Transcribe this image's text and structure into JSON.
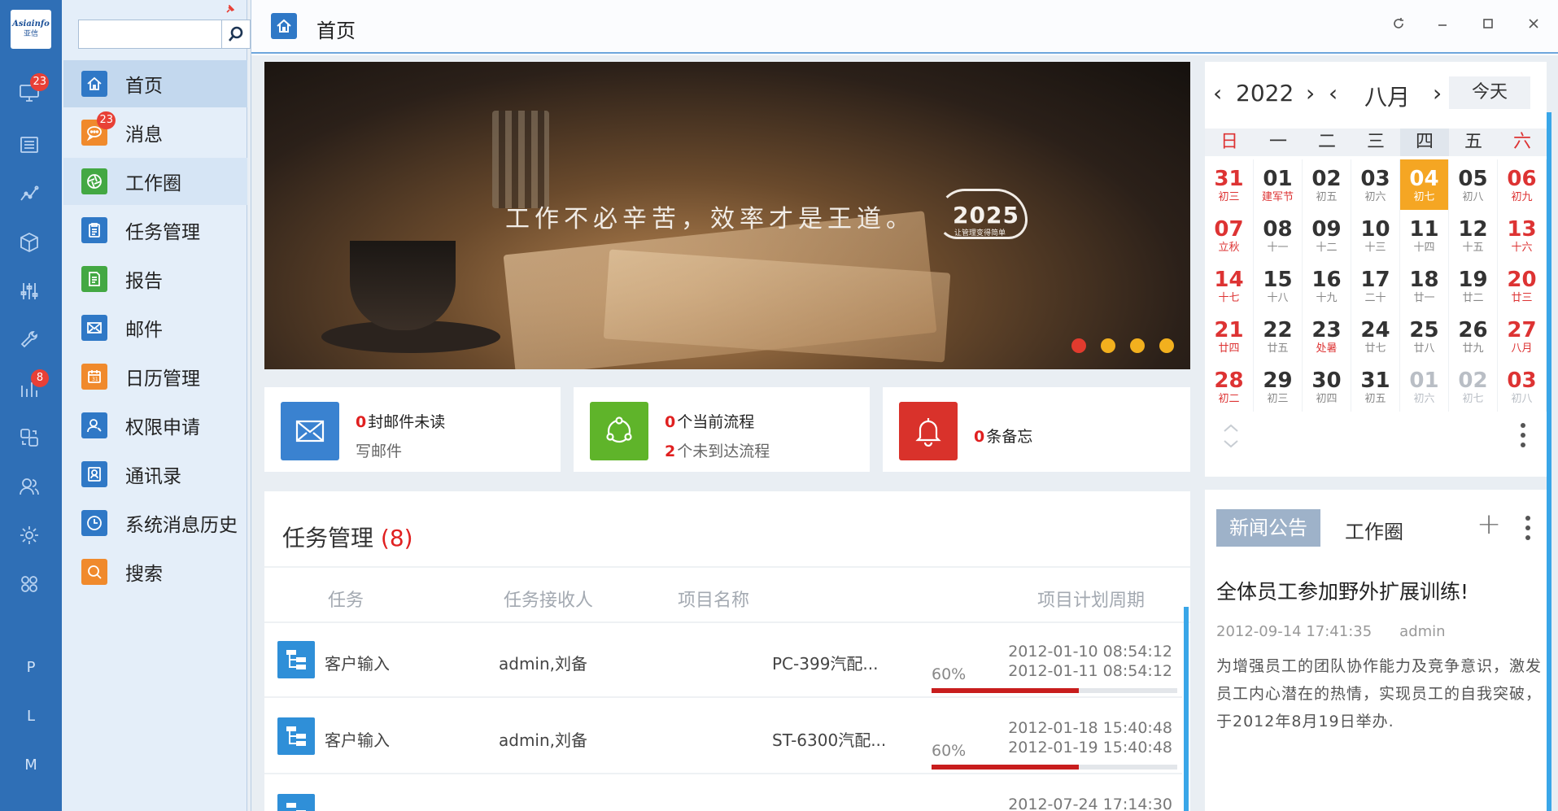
{
  "rail": {
    "logo_line1": "Asiainfo",
    "logo_line2": "亚信",
    "badges": {
      "monitor": "23",
      "stats": "8"
    },
    "letters": [
      "P",
      "L",
      "M"
    ]
  },
  "nav": {
    "search_placeholder": "",
    "items": [
      {
        "label": "首页",
        "color": "#2f78c6"
      },
      {
        "label": "消息",
        "color": "#f08a2c",
        "badge": "23"
      },
      {
        "label": "工作圈",
        "color": "#43a843"
      },
      {
        "label": "任务管理",
        "color": "#2f78c6"
      },
      {
        "label": "报告",
        "color": "#43a843"
      },
      {
        "label": "邮件",
        "color": "#2f78c6"
      },
      {
        "label": "日历管理",
        "color": "#f08a2c"
      },
      {
        "label": "权限申请",
        "color": "#2f78c6"
      },
      {
        "label": "通讯录",
        "color": "#2f78c6"
      },
      {
        "label": "系统消息历史",
        "color": "#2f78c6"
      },
      {
        "label": "搜索",
        "color": "#f08a2c"
      }
    ]
  },
  "window": {
    "title": "首页"
  },
  "banner": {
    "slogan": "工作不必辛苦，效率才是王道。",
    "brand": "2025",
    "brand_sub": "让管理变得简单",
    "dot_colors": [
      "#e23b2e",
      "#f2b01e",
      "#f2b01e",
      "#f2b01e"
    ]
  },
  "cards": {
    "mail": {
      "count": "0",
      "unread_text": "封邮件未读",
      "write": "写邮件",
      "color": "#3a82d0"
    },
    "flow": {
      "count": "0",
      "current_text": "个当前流程",
      "count2": "2",
      "pending_text": "个未到达流程",
      "color": "#5fb42a"
    },
    "memo": {
      "count": "0",
      "text": "条备忘",
      "color": "#d9322b"
    }
  },
  "calendar": {
    "year": "2022",
    "month": "八月",
    "today_label": "今天",
    "weekdays": [
      "日",
      "一",
      "二",
      "三",
      "四",
      "五",
      "六"
    ],
    "weeks": [
      [
        {
          "d": "31",
          "l": "初三"
        },
        {
          "d": "01",
          "l": "建军节"
        },
        {
          "d": "02",
          "l": "初五"
        },
        {
          "d": "03",
          "l": "初六"
        },
        {
          "d": "04",
          "l": "初七"
        },
        {
          "d": "05",
          "l": "初八"
        },
        {
          "d": "06",
          "l": "初九"
        }
      ],
      [
        {
          "d": "07",
          "l": "立秋"
        },
        {
          "d": "08",
          "l": "十一"
        },
        {
          "d": "09",
          "l": "十二"
        },
        {
          "d": "10",
          "l": "十三"
        },
        {
          "d": "11",
          "l": "十四"
        },
        {
          "d": "12",
          "l": "十五"
        },
        {
          "d": "13",
          "l": "十六"
        }
      ],
      [
        {
          "d": "14",
          "l": "十七"
        },
        {
          "d": "15",
          "l": "十八"
        },
        {
          "d": "16",
          "l": "十九"
        },
        {
          "d": "17",
          "l": "二十"
        },
        {
          "d": "18",
          "l": "廿一"
        },
        {
          "d": "19",
          "l": "廿二"
        },
        {
          "d": "20",
          "l": "廿三"
        }
      ],
      [
        {
          "d": "21",
          "l": "廿四"
        },
        {
          "d": "22",
          "l": "廿五"
        },
        {
          "d": "23",
          "l": "处暑"
        },
        {
          "d": "24",
          "l": "廿七"
        },
        {
          "d": "25",
          "l": "廿八"
        },
        {
          "d": "26",
          "l": "廿九"
        },
        {
          "d": "27",
          "l": "八月"
        }
      ],
      [
        {
          "d": "28",
          "l": "初二"
        },
        {
          "d": "29",
          "l": "初三"
        },
        {
          "d": "30",
          "l": "初四"
        },
        {
          "d": "31",
          "l": "初五"
        },
        {
          "d": "01",
          "l": "初六"
        },
        {
          "d": "02",
          "l": "初七"
        },
        {
          "d": "03",
          "l": "初八"
        }
      ]
    ],
    "selected": "04"
  },
  "tasks": {
    "title": "任务管理",
    "count": "(8)",
    "columns": [
      "任务",
      "任务接收人",
      "项目名称",
      "项目计划周期"
    ],
    "rows": [
      {
        "task": "客户输入",
        "assignee": "admin,刘备",
        "project": "PC-399汽配...",
        "progress": "60%",
        "start": "2012-01-10 08:54:12",
        "end": "2012-01-11 08:54:12"
      },
      {
        "task": "客户输入",
        "assignee": "admin,刘备",
        "project": "ST-6300汽配...",
        "progress": "60%",
        "start": "2012-01-18 15:40:48",
        "end": "2012-01-19 15:40:48"
      },
      {
        "task": "",
        "assignee": "",
        "project": "",
        "progress": "",
        "start": "2012-07-24 17:14:30",
        "end": ""
      }
    ]
  },
  "news": {
    "tabs": [
      "新闻公告",
      "工作圈"
    ],
    "add": "+",
    "title": "全体员工参加野外扩展训练!",
    "date": "2012-09-14 17:41:35",
    "author": "admin",
    "body": "为增强员工的团队协作能力及竞争意识，激发员工内心潜在的热情，实现员工的自我突破，于2012年8月19日举办."
  }
}
